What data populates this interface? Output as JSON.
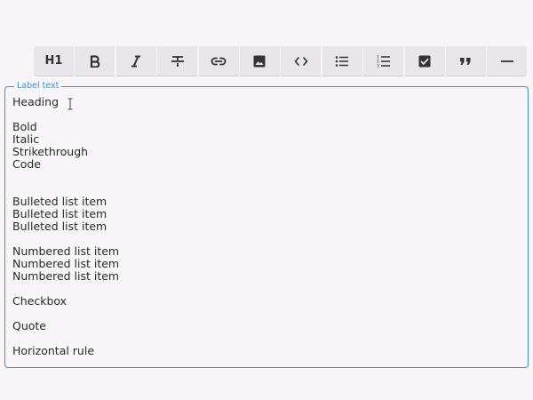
{
  "toolbar": {
    "heading_label": "H1",
    "buttons": [
      {
        "icon": "heading-icon"
      },
      {
        "icon": "bold-icon"
      },
      {
        "icon": "italic-icon"
      },
      {
        "icon": "strikethrough-icon"
      },
      {
        "icon": "link-icon"
      },
      {
        "icon": "image-icon"
      },
      {
        "icon": "code-icon"
      },
      {
        "icon": "bulleted-list-icon"
      },
      {
        "icon": "numbered-list-icon"
      },
      {
        "icon": "checkbox-icon"
      },
      {
        "icon": "quote-icon"
      },
      {
        "icon": "horizontal-rule-icon"
      }
    ]
  },
  "editor": {
    "label": "Label text",
    "lines": {
      "heading": "Heading",
      "bold": "Bold",
      "italic": "Italic",
      "strikethrough": "Strikethrough",
      "code": "Code",
      "bullets": [
        "Bulleted list item",
        "Bulleted list item",
        "Bulleted list item"
      ],
      "numbers": [
        "Numbered list item",
        "Numbered list item",
        "Numbered list item"
      ],
      "checkbox": "Checkbox",
      "quote": "Quote",
      "hr": "Horizontal rule"
    }
  },
  "colors": {
    "accent": "#3d8fd1",
    "toolbar_bg": "#e8e6eb",
    "page_bg": "#f7f5f8"
  }
}
